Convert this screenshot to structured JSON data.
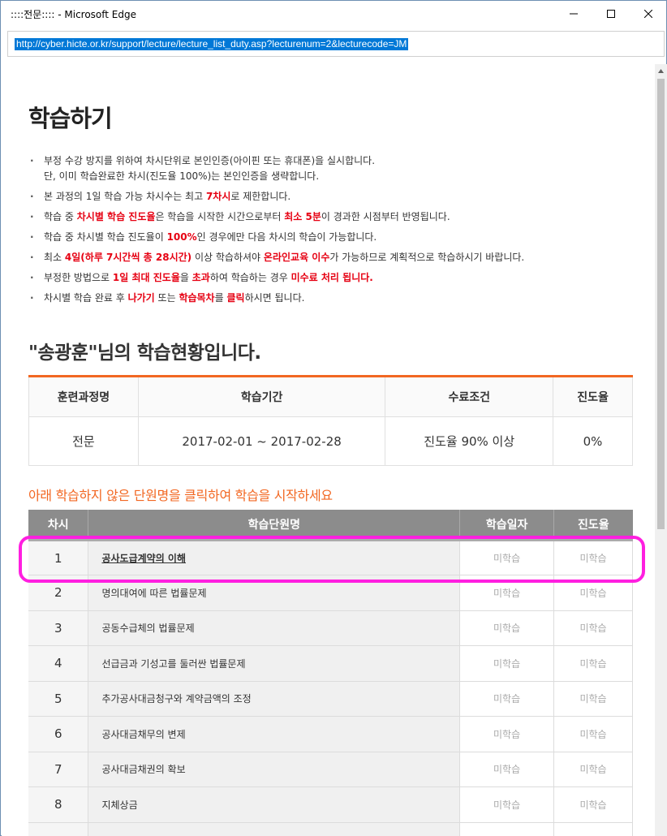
{
  "window": {
    "title": "::::전문:::: - Microsoft Edge",
    "url": "http://cyber.hicte.or.kr/support/lecture/lecture_list_duty.asp?lecturenum=2&lecturecode=JM"
  },
  "page": {
    "title": "학습하기",
    "notices": [
      {
        "line1": "부정 수강 방지를 위하여 차시단위로 본인인증(아이핀 또는 휴대폰)을 실시합니다.",
        "line2": "단, 이미 학습완료한 차시(진도율 100%)는 본인인증을 생략합니다."
      },
      {
        "pre": "본 과정의 1일 학습 가능 차시수는 최고 ",
        "red1": "7차시",
        "post": "로 제한합니다."
      },
      {
        "pre": "학습 중 ",
        "red1": "차시별 학습 진도율",
        "mid": "은 학습을 시작한 시간으로부터 ",
        "red2": "최소 5분",
        "post": "이 경과한 시점부터 반영됩니다."
      },
      {
        "pre": "학습 중 차시별 학습 진도율이 ",
        "red1": "100%",
        "post": "인 경우에만 다음 차시의 학습이 가능합니다."
      },
      {
        "pre": "최소 ",
        "red1": "4일(하루 7시간씩 총 28시간)",
        "mid": " 이상 학습하셔야 ",
        "red2": "온라인교육 이수",
        "post": "가 가능하므로 계획적으로 학습하시기 바랍니다."
      },
      {
        "pre": "부정한 방법으로 ",
        "red1": "1일 최대 진도율",
        "mid": "을 ",
        "red2": "초과",
        "mid2": "하여 학습하는 경우 ",
        "red3": "미수료 처리 됩니다."
      },
      {
        "pre": "차시별 학습 완료 후 ",
        "red1": "나가기",
        "mid": " 또는 ",
        "red2": "학습목차",
        "mid2": "를 ",
        "red3": "클릭",
        "post": "하시면 됩니다."
      }
    ],
    "status_heading": "\"송광훈\"님의 학습현황입니다."
  },
  "summary": {
    "headers": [
      "훈련과정명",
      "학습기간",
      "수료조건",
      "진도율"
    ],
    "row": [
      "전문",
      "2017-02-01 ~ 2017-02-28",
      "진도율 90% 이상",
      "0%"
    ]
  },
  "instruction": "아래 학습하지 않은 단원명을 클릭하여 학습을 시작하세요",
  "units": {
    "headers": [
      "차시",
      "학습단원명",
      "학습일자",
      "진도율"
    ],
    "rows": [
      {
        "num": "1",
        "name": "공사도급계약의 이해",
        "date": "미학습",
        "progress": "미학습"
      },
      {
        "num": "2",
        "name": "명의대여에 따른 법률문제",
        "date": "미학습",
        "progress": "미학습"
      },
      {
        "num": "3",
        "name": "공동수급체의 법률문제",
        "date": "미학습",
        "progress": "미학습"
      },
      {
        "num": "4",
        "name": "선급금과 기성고를 둘러싼 법률문제",
        "date": "미학습",
        "progress": "미학습"
      },
      {
        "num": "5",
        "name": "추가공사대금청구와 계약금액의 조정",
        "date": "미학습",
        "progress": "미학습"
      },
      {
        "num": "6",
        "name": "공사대금채무의 변제",
        "date": "미학습",
        "progress": "미학습"
      },
      {
        "num": "7",
        "name": "공사대금채권의 확보",
        "date": "미학습",
        "progress": "미학습"
      },
      {
        "num": "8",
        "name": "지체상금",
        "date": "미학습",
        "progress": "미학습"
      },
      {
        "num": "",
        "name": "",
        "date": "",
        "progress": ""
      }
    ]
  },
  "colors": {
    "accent": "#f26722",
    "emphasis": "#e60012",
    "highlight": "#ff1fe0",
    "header_bg": "#8c8c8c"
  }
}
